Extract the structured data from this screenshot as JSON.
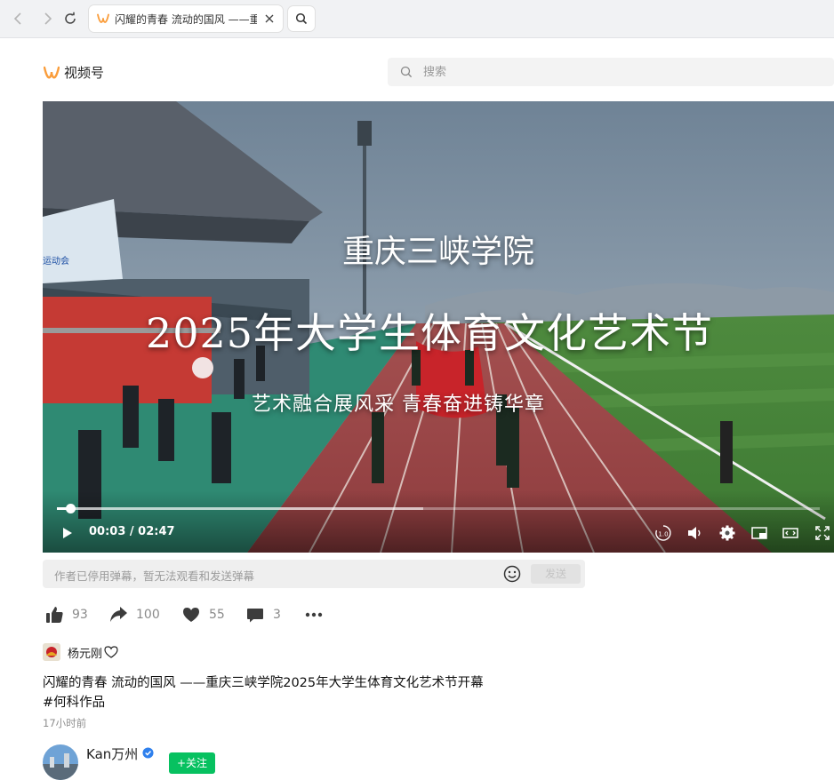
{
  "browser": {
    "tab_title": "闪耀的青春 流动的国风 ——重庆三峡学院2025年大学生体育文化艺术节开幕"
  },
  "site": {
    "brand": "视频号",
    "search_placeholder": "搜索"
  },
  "video": {
    "overlay_line1": "重庆三峡学院",
    "overlay_line2": "2025年大学生体育文化艺术节",
    "overlay_line3": "艺术融合展风采  青春奋进铸华章",
    "current_time": "00:03",
    "duration": "02:47",
    "time_display": "00:03 / 02:47",
    "played_fraction": 0.018,
    "buffered_fraction": 0.48,
    "playback_speed_label": "1.0",
    "stadium_banner": "运动会"
  },
  "danmaku": {
    "placeholder": "作者已停用弹幕，暂无法观看和发送弹幕",
    "send_label": "发送"
  },
  "stats": {
    "likes": "93",
    "shares": "100",
    "favorites": "55",
    "comments": "3"
  },
  "author": {
    "name": "杨元刚"
  },
  "post": {
    "title": "闪耀的青春 流动的国风 ——重庆三峡学院2025年大学生体育文化艺术节开幕",
    "hashtag": "#何科作品",
    "time_ago": "17小时前"
  },
  "channel": {
    "name": "Kan万州",
    "follow_label": "+关注"
  },
  "colors": {
    "accent_green": "#07c160",
    "brand_orange": "#fa9d3b",
    "verified_blue": "#2f80ed"
  }
}
